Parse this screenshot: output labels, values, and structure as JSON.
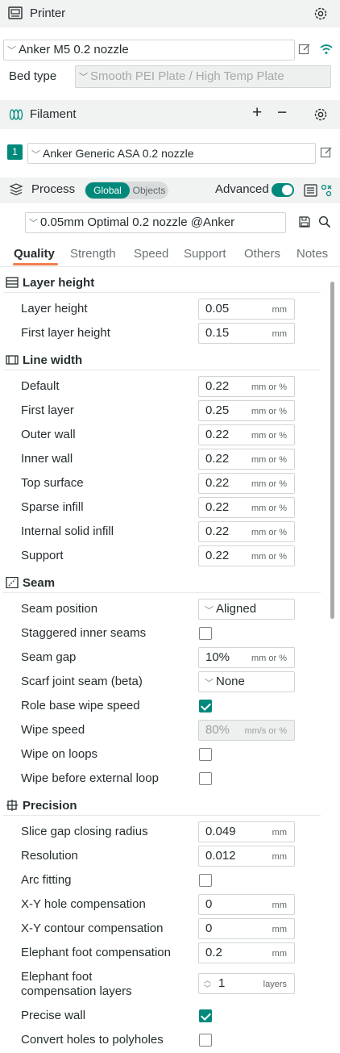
{
  "printer": {
    "title": "Printer",
    "preset": "Anker M5 0.2 nozzle",
    "bed_type_label": "Bed type",
    "bed_type_value": "Smooth PEI Plate / High Temp Plate"
  },
  "filament": {
    "title": "Filament",
    "add_label": "+",
    "remove_label": "−",
    "slot_number": "1",
    "preset": "Anker Generic ASA 0.2 nozzle"
  },
  "process": {
    "title": "Process",
    "toggle_global": "Global",
    "toggle_objects": "Objects",
    "advanced_label": "Advanced",
    "advanced_on": true,
    "preset": "0.05mm Optimal 0.2 nozzle @Anker"
  },
  "tabs": [
    {
      "label": "Quality",
      "active": true
    },
    {
      "label": "Strength",
      "active": false
    },
    {
      "label": "Speed",
      "active": false
    },
    {
      "label": "Support",
      "active": false
    },
    {
      "label": "Others",
      "active": false
    },
    {
      "label": "Notes",
      "active": false
    }
  ],
  "sections": {
    "layer_height": {
      "title": "Layer height",
      "rows": [
        {
          "label": "Layer height",
          "value": "0.05",
          "unit": "mm"
        },
        {
          "label": "First layer height",
          "value": "0.15",
          "unit": "mm"
        }
      ]
    },
    "line_width": {
      "title": "Line width",
      "rows": [
        {
          "label": "Default",
          "value": "0.22",
          "unit": "mm or %"
        },
        {
          "label": "First layer",
          "value": "0.25",
          "unit": "mm or %"
        },
        {
          "label": "Outer wall",
          "value": "0.22",
          "unit": "mm or %"
        },
        {
          "label": "Inner wall",
          "value": "0.22",
          "unit": "mm or %"
        },
        {
          "label": "Top surface",
          "value": "0.22",
          "unit": "mm or %"
        },
        {
          "label": "Sparse infill",
          "value": "0.22",
          "unit": "mm or %"
        },
        {
          "label": "Internal solid infill",
          "value": "0.22",
          "unit": "mm or %"
        },
        {
          "label": "Support",
          "value": "0.22",
          "unit": "mm or %"
        }
      ]
    },
    "seam": {
      "title": "Seam",
      "seam_position_label": "Seam position",
      "seam_position_value": "Aligned",
      "staggered_label": "Staggered inner seams",
      "staggered_checked": false,
      "seam_gap_label": "Seam gap",
      "seam_gap_value": "10%",
      "seam_gap_unit": "mm or %",
      "scarf_label": "Scarf joint seam (beta)",
      "scarf_value": "None",
      "role_wipe_label": "Role base wipe speed",
      "role_wipe_checked": true,
      "wipe_speed_label": "Wipe speed",
      "wipe_speed_value": "80%",
      "wipe_speed_unit": "mm/s or %",
      "wipe_loops_label": "Wipe on loops",
      "wipe_loops_checked": false,
      "wipe_before_label": "Wipe before external loop",
      "wipe_before_checked": false
    },
    "precision": {
      "title": "Precision",
      "slice_gap_label": "Slice gap closing radius",
      "slice_gap_value": "0.049",
      "slice_gap_unit": "mm",
      "resolution_label": "Resolution",
      "resolution_value": "0.012",
      "resolution_unit": "mm",
      "arc_label": "Arc fitting",
      "arc_checked": false,
      "xy_hole_label": "X-Y hole compensation",
      "xy_hole_value": "0",
      "xy_hole_unit": "mm",
      "xy_contour_label": "X-Y contour compensation",
      "xy_contour_value": "0",
      "xy_contour_unit": "mm",
      "elephant_label": "Elephant foot compensation",
      "elephant_value": "0.2",
      "elephant_unit": "mm",
      "elephant_layers_label_1": "Elephant foot",
      "elephant_layers_label_2": "compensation layers",
      "elephant_layers_value": "1",
      "elephant_layers_unit": "layers",
      "precise_wall_label": "Precise wall",
      "precise_wall_checked": true,
      "polyholes_label": "Convert holes to polyholes",
      "polyholes_checked": false
    }
  },
  "colors": {
    "accent": "#00897b",
    "tab_underline": "#ef7f4f",
    "header_bg": "#f1f2f2"
  }
}
